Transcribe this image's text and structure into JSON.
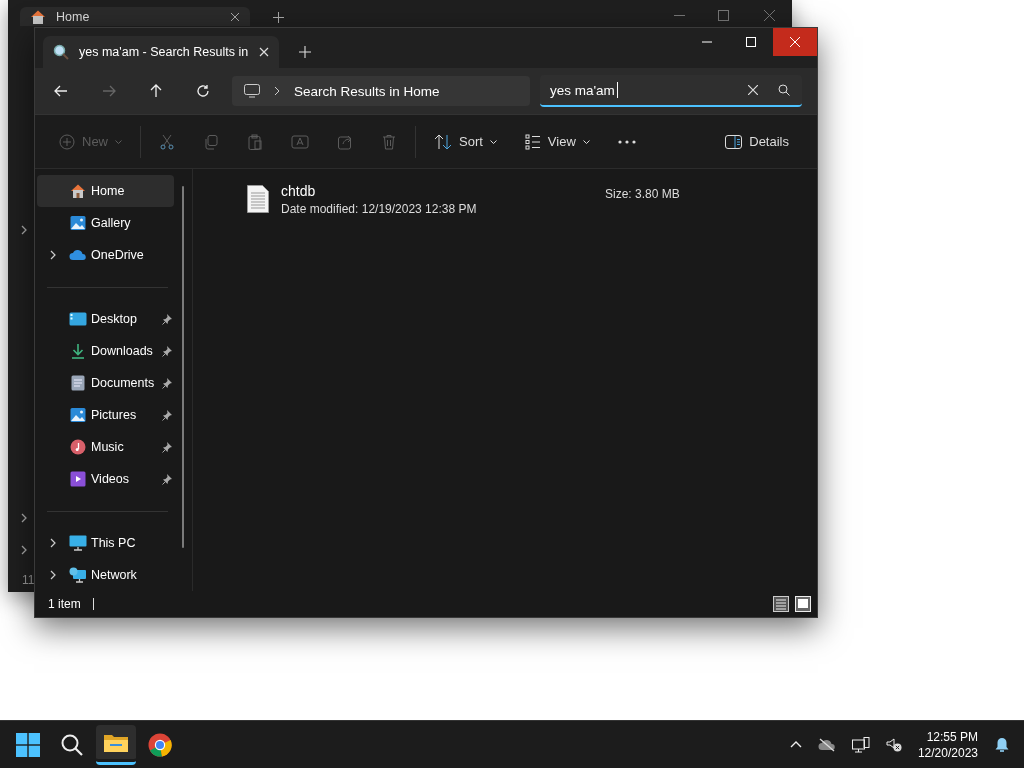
{
  "background_window": {
    "tab": {
      "label": "Home"
    },
    "status": "11"
  },
  "window": {
    "tabs": [
      {
        "label": "yes ma'am - Search Results in",
        "selected": true
      }
    ],
    "address": {
      "path": "Search Results in Home"
    },
    "search": {
      "value": "yes ma'am"
    },
    "toolbar": [
      {
        "kind": "new",
        "label": "New",
        "disabled": true
      },
      {
        "kind": "cut",
        "disabled": true
      },
      {
        "kind": "copy",
        "disabled": true
      },
      {
        "kind": "paste",
        "disabled": true
      },
      {
        "kind": "rename",
        "disabled": true
      },
      {
        "kind": "share",
        "disabled": true
      },
      {
        "kind": "delete",
        "disabled": true
      },
      {
        "kind": "sort",
        "label": "Sort",
        "disabled": false
      },
      {
        "kind": "view",
        "label": "View",
        "disabled": false
      },
      {
        "kind": "more",
        "disabled": false
      },
      {
        "kind": "details",
        "label": "Details",
        "disabled": false
      }
    ],
    "sidebar": {
      "groups": [
        [
          {
            "kind": "home",
            "label": "Home",
            "selected": true,
            "expandable": false,
            "pinned": false
          },
          {
            "kind": "gallery",
            "label": "Gallery",
            "selected": false,
            "expandable": false,
            "pinned": false
          },
          {
            "kind": "cloud",
            "label": "OneDrive",
            "selected": false,
            "expandable": true,
            "pinned": false
          }
        ],
        [
          {
            "kind": "desktop",
            "label": "Desktop",
            "selected": false,
            "expandable": false,
            "pinned": true
          },
          {
            "kind": "downloads",
            "label": "Downloads",
            "selected": false,
            "expandable": false,
            "pinned": true
          },
          {
            "kind": "documents",
            "label": "Documents",
            "selected": false,
            "expandable": false,
            "pinned": true
          },
          {
            "kind": "pictures",
            "label": "Pictures",
            "selected": false,
            "expandable": false,
            "pinned": true
          },
          {
            "kind": "music",
            "label": "Music",
            "selected": false,
            "expandable": false,
            "pinned": true
          },
          {
            "kind": "videos",
            "label": "Videos",
            "selected": false,
            "expandable": false,
            "pinned": true
          }
        ],
        [
          {
            "kind": "pc",
            "label": "This PC",
            "selected": false,
            "expandable": true,
            "pinned": false
          },
          {
            "kind": "network",
            "label": "Network",
            "selected": false,
            "expandable": true,
            "pinned": false
          }
        ]
      ]
    },
    "results": [
      {
        "name": "chtdb",
        "modified_label": "Date modified:",
        "modified": "12/19/2023 12:38 PM",
        "size_label": "Size:",
        "size": "3.80 MB"
      }
    ],
    "status_bar": {
      "count": "1 item"
    }
  },
  "taskbar": {
    "apps": [
      {
        "kind": "start",
        "selected": false
      },
      {
        "kind": "search",
        "selected": false
      },
      {
        "kind": "explorer",
        "selected": true
      },
      {
        "kind": "browser",
        "selected": false
      }
    ],
    "time": "12:55 PM",
    "date": "12/20/2023"
  }
}
